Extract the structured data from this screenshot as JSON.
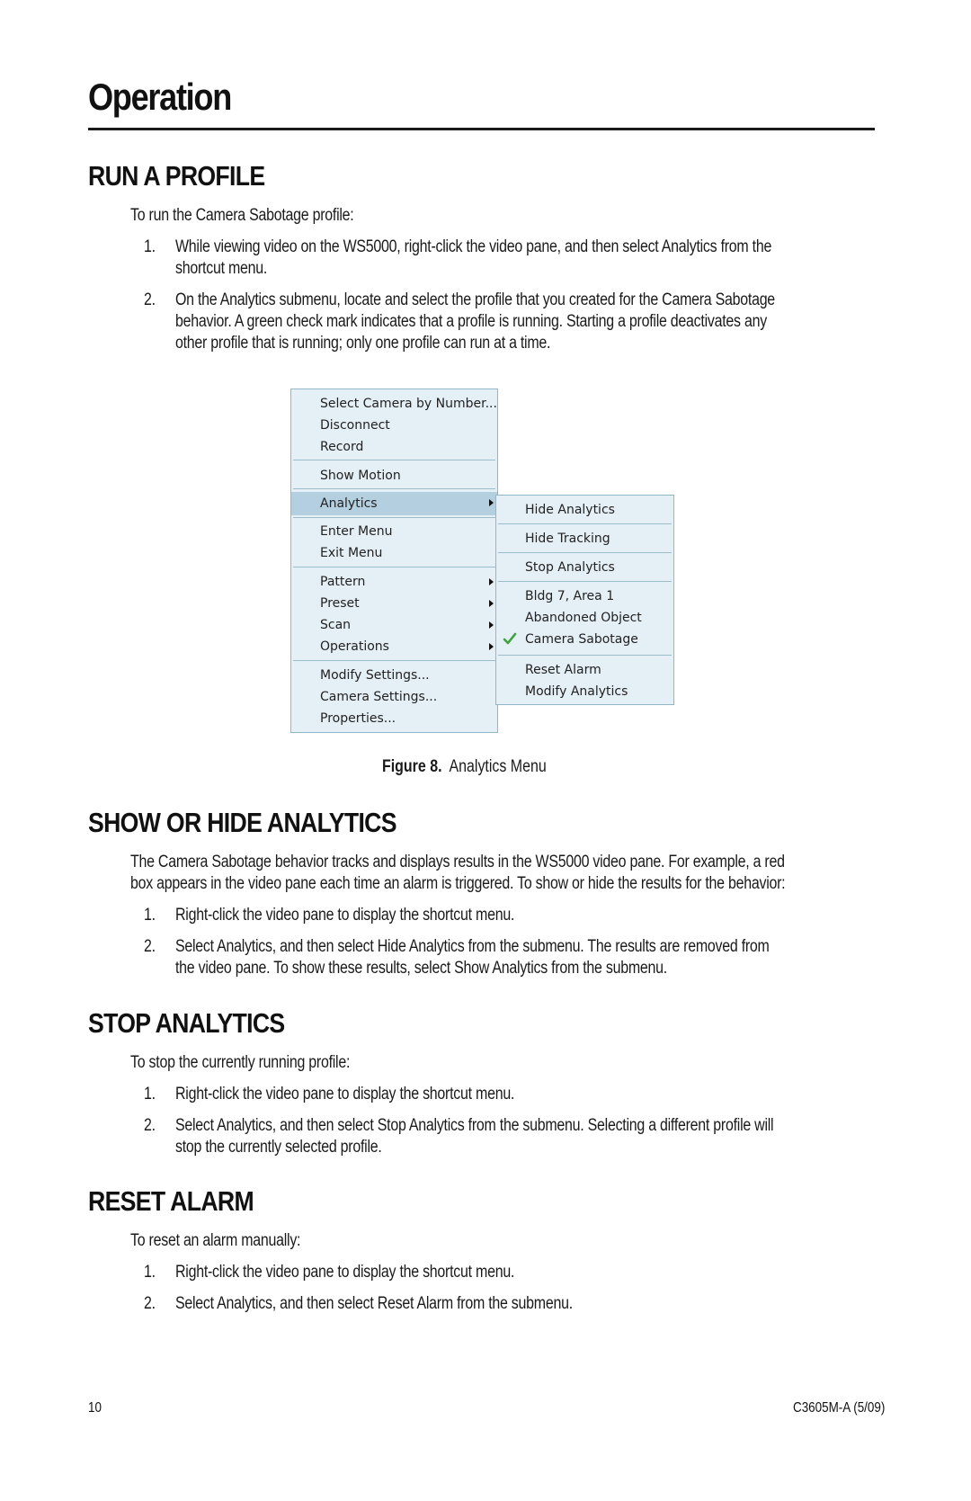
{
  "page": {
    "title": "Operation",
    "page_number": "10",
    "doc_id": "C3605M-A  (5/09)"
  },
  "run_profile": {
    "heading": "RUN A PROFILE",
    "intro": "To run the Camera Sabotage profile:",
    "steps": [
      {
        "num": "1.",
        "lines": [
          "While viewing video on the WS5000, right-click the video pane, and then select Analytics from the",
          "shortcut menu."
        ]
      },
      {
        "num": "2.",
        "lines": [
          "On the Analytics submenu, locate and select the profile that you created for the Camera Sabotage",
          "behavior. A green check mark indicates that a profile is running. Starting a profile deactivates any",
          "other profile that is running; only one profile can run at a time."
        ]
      }
    ]
  },
  "figure": {
    "label": "Figure 8.",
    "caption": "Analytics Menu",
    "main_menu": [
      "Select Camera by Number...",
      "Disconnect",
      "Record",
      "Show Motion",
      "Analytics",
      "Enter Menu",
      "Exit Menu",
      "Pattern",
      "Preset",
      "Scan",
      "Operations",
      "Modify Settings...",
      "Camera Settings...",
      "Properties..."
    ],
    "sub_menu": [
      "Hide Analytics",
      "Hide Tracking",
      "Stop Analytics",
      "Bldg 7, Area 1",
      "Abandoned Object",
      "Camera Sabotage",
      "Reset Alarm",
      "Modify Analytics"
    ],
    "checked_item": "Camera Sabotage",
    "highlighted_item": "Analytics",
    "colors": {
      "menu_bg": "#e5eff6",
      "highlight": "#b3cfe0",
      "check": "#3ca23c"
    }
  },
  "show_hide": {
    "heading": "SHOW OR HIDE ANALYTICS",
    "para": [
      "The Camera Sabotage behavior tracks and displays results in the WS5000 video pane. For example, a red",
      "box appears in the video pane each time an alarm is triggered. To show or hide the results for the behavior:"
    ],
    "steps": [
      {
        "num": "1.",
        "lines": [
          "Right-click the video pane to display the shortcut menu."
        ]
      },
      {
        "num": "2.",
        "lines": [
          "Select Analytics, and then select Hide Analytics from the submenu. The results are removed from",
          "the video pane. To show these results, select Show Analytics from the submenu."
        ]
      }
    ]
  },
  "stop": {
    "heading": "STOP ANALYTICS",
    "intro": "To stop the currently running profile:",
    "steps": [
      {
        "num": "1.",
        "lines": [
          "Right-click the video pane to display the shortcut menu."
        ]
      },
      {
        "num": "2.",
        "lines": [
          "Select Analytics, and then select Stop Analytics from the submenu. Selecting a different profile will",
          "stop the currently selected profile."
        ]
      }
    ]
  },
  "reset": {
    "heading": "RESET ALARM",
    "intro": "To reset an alarm manually:",
    "steps": [
      {
        "num": "1.",
        "lines": [
          "Right-click the video pane to display the shortcut menu."
        ]
      },
      {
        "num": "2.",
        "lines": [
          "Select Analytics, and then select Reset Alarm from the submenu."
        ]
      }
    ]
  }
}
